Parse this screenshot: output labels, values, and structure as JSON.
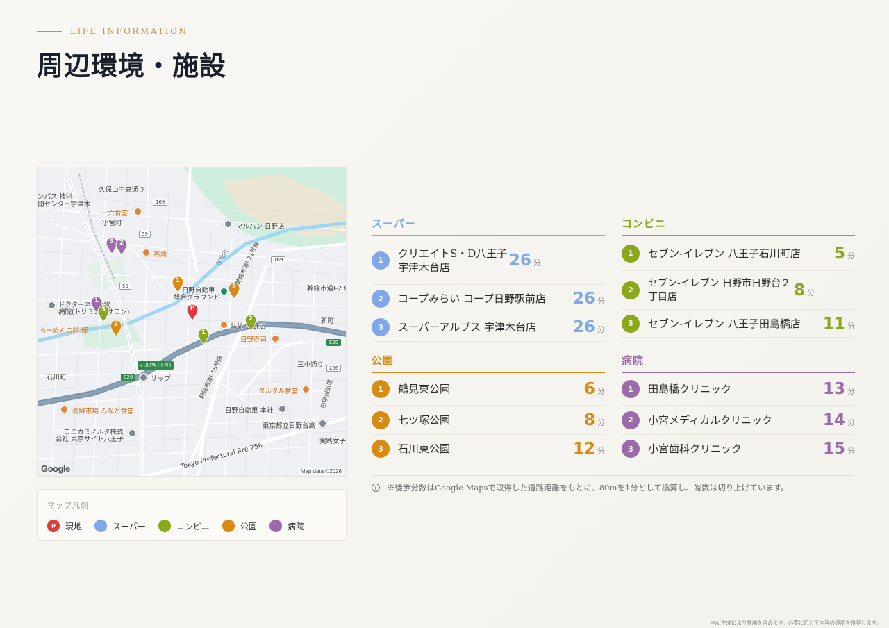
{
  "header": {
    "eyebrow": "LIFE INFORMATION",
    "title": "周辺環境・施設"
  },
  "colors": {
    "gold": "#b8955a",
    "supermarket": "#7fa8e8",
    "convenience": "#8aa81c",
    "park": "#d98a12",
    "hospital": "#9a6ba8",
    "current": "#e03a3a"
  },
  "map": {
    "labels": {
      "kubosan": "久保山中央通り",
      "olympus": "ンパス 技術",
      "olympus2": "開センター宇津木",
      "ichiroku": "一六食堂",
      "komiyacho": "小宮町",
      "maruhan": "マルハン 日野店",
      "takase": "高瀬",
      "hino_ground1": "日野自動車",
      "hino_ground2": "総合グラウンド",
      "doctor1": "ドクターネコ動物",
      "doctor2": "病院(トリミングサロン)",
      "ramen": "らーめんの館 輝",
      "shinmachi": "新町",
      "ishikawa_pa": "石川PA (下り)",
      "sap": "サップ",
      "ishikawacho": "石川町",
      "mitsuya": "三小通り",
      "tartar": "タルタル食堂",
      "kaisen": "海鮮市場 みなと食堂",
      "hino_honsha": "日野自動車 本社",
      "konica1": "コニカミノルタ株式",
      "konica2": "会社 東京サイト八王子",
      "hino_school": "東京都立日野台高",
      "jissen": "実践女子",
      "hino_sushi": "日野寿司",
      "ajidokoro": "味処 日野店",
      "kyuminami": "旧甲州街道",
      "prefectural": "Tokyo Prefectural Rte 256",
      "kansen23": "幹線市道I-23号",
      "kansen21": "幹線市道I-21号線",
      "kansen15": "幹線市道I-15号線",
      "yachi": "谷地川",
      "route169": "169",
      "route59": "59",
      "routeE20": "E20",
      "route256": "256"
    },
    "google": "Google",
    "map_data": "Map data ©2026"
  },
  "legend": {
    "title": "マップ凡例",
    "items": [
      {
        "label": "現地",
        "color": "#e03a3a",
        "mark": "P"
      },
      {
        "label": "スーパー",
        "color": "#7fa8e8",
        "mark": ""
      },
      {
        "label": "コンビニ",
        "color": "#8aa81c",
        "mark": ""
      },
      {
        "label": "公園",
        "color": "#d98a12",
        "mark": ""
      },
      {
        "label": "病院",
        "color": "#9a6ba8",
        "mark": ""
      }
    ]
  },
  "categories": {
    "supermarket": {
      "title": "スーパー",
      "unit": "分",
      "items": [
        {
          "no": "1",
          "name": "クリエイトS・D八王子宇津木台店",
          "minutes": "26"
        },
        {
          "no": "2",
          "name": "コープみらい コープ日野駅前店",
          "minutes": "26"
        },
        {
          "no": "3",
          "name": "スーパーアルプス 宇津木台店",
          "minutes": "26"
        }
      ]
    },
    "convenience": {
      "title": "コンビニ",
      "unit": "分",
      "items": [
        {
          "no": "1",
          "name": "セブン-イレブン 八王子石川町店",
          "minutes": "5"
        },
        {
          "no": "2",
          "name": "セブン-イレブン 日野市日野台２丁目店",
          "minutes": "8"
        },
        {
          "no": "3",
          "name": "セブン-イレブン 八王子田島橋店",
          "minutes": "11"
        }
      ]
    },
    "park": {
      "title": "公園",
      "unit": "分",
      "items": [
        {
          "no": "1",
          "name": "鶴見東公園",
          "minutes": "6"
        },
        {
          "no": "2",
          "name": "七ツ塚公園",
          "minutes": "8"
        },
        {
          "no": "3",
          "name": "石川東公園",
          "minutes": "12"
        }
      ]
    },
    "hospital": {
      "title": "病院",
      "unit": "分",
      "items": [
        {
          "no": "1",
          "name": "田島橋クリニック",
          "minutes": "13"
        },
        {
          "no": "2",
          "name": "小宮メディカルクリニック",
          "minutes": "14"
        },
        {
          "no": "3",
          "name": "小宮歯科クリニック",
          "minutes": "15"
        }
      ]
    }
  },
  "note": "※徒歩分数はGoogle Mapsで取得した道路距離をもとに、80mを1分として換算し、端数は切り上げています。",
  "disclaimer": "※AI生成により推論を含みます。必要に応じて内容の確認を推奨します。"
}
